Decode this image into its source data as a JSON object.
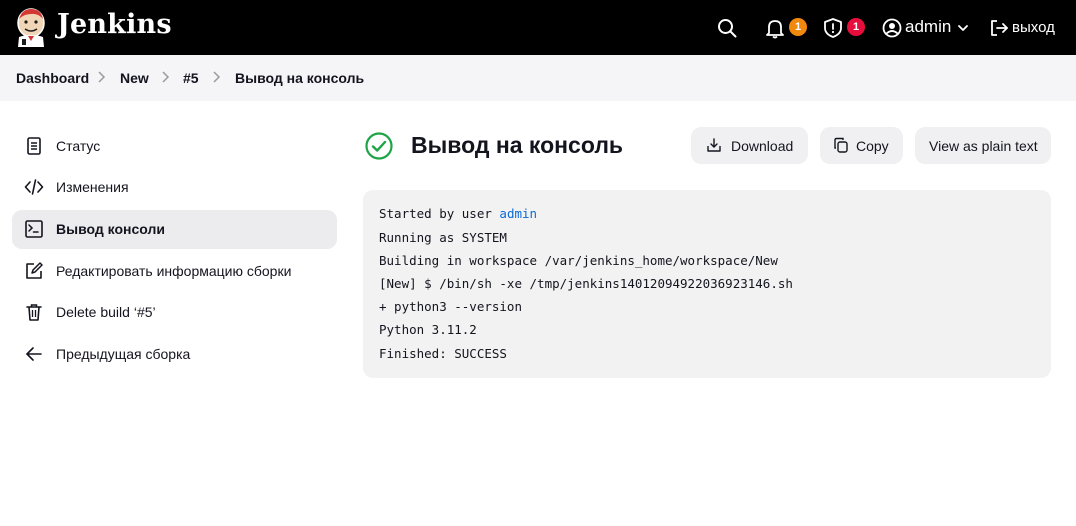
{
  "header": {
    "brand": "Jenkins",
    "notifications_count": "1",
    "security_count": "1",
    "user": "admin",
    "logout_label": "выход"
  },
  "breadcrumbs": [
    "Dashboard",
    "New",
    "#5",
    "Вывод на консоль"
  ],
  "sidebar": {
    "items": [
      {
        "label": "Статус",
        "icon": "document-icon",
        "active": false
      },
      {
        "label": "Изменения",
        "icon": "code-icon",
        "active": false
      },
      {
        "label": "Вывод консоли",
        "icon": "terminal-icon",
        "active": true
      },
      {
        "label": "Редактировать информацию сборки",
        "icon": "edit-icon",
        "active": false
      },
      {
        "label": "Delete build ‘#5’",
        "icon": "trash-icon",
        "active": false
      },
      {
        "label": "Предыдущая сборка",
        "icon": "arrow-left-icon",
        "active": false
      }
    ]
  },
  "main": {
    "title": "Вывод на консоль",
    "status": "success",
    "buttons": {
      "download": "Download",
      "copy": "Copy",
      "plain_text": "View as plain text"
    },
    "console": {
      "started_prefix": "Started by user ",
      "started_user": "admin",
      "lines": [
        "Running as SYSTEM",
        "Building in workspace /var/jenkins_home/workspace/New",
        "[New] $ /bin/sh -xe /tmp/jenkins14012094922036923146.sh",
        "+ python3 --version",
        "Python 3.11.2",
        "Finished: SUCCESS"
      ]
    }
  },
  "colors": {
    "header_bg": "#000000",
    "success_green": "#1ea446",
    "badge_orange": "#f2890f",
    "badge_red": "#e60f3c",
    "link_blue": "#0b6bd6"
  }
}
